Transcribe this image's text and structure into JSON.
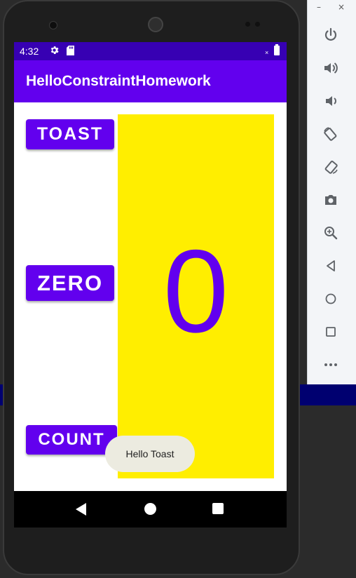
{
  "status_bar": {
    "time": "4:32",
    "settings_icon": "gear-icon",
    "sd_icon": "sd-card-icon",
    "no_signal_icon": "no-signal-icon",
    "battery_icon": "battery-icon"
  },
  "app_bar": {
    "title": "HelloConstraintHomework"
  },
  "main": {
    "toast_button_label": "TOAST",
    "zero_button_label": "ZERO",
    "count_button_label": "COUNT",
    "count_value": "0",
    "toast_message": "Hello Toast"
  },
  "nav_bar": {
    "back_icon": "back-icon",
    "home_icon": "home-icon",
    "recents_icon": "recents-icon"
  },
  "emulator_toolbar": {
    "minimize_label": "–",
    "close_label": "×",
    "tools": [
      "power-icon",
      "volume-up-icon",
      "volume-down-icon",
      "rotate-left-icon",
      "rotate-right-icon",
      "camera-icon",
      "zoom-icon",
      "back-icon",
      "home-icon",
      "overview-icon",
      "more-icon"
    ]
  },
  "colors": {
    "primary": "#6200ee",
    "status_bar": "#3700b3",
    "count_panel": "#ffee00",
    "toast_bg": "#ecebe0"
  }
}
